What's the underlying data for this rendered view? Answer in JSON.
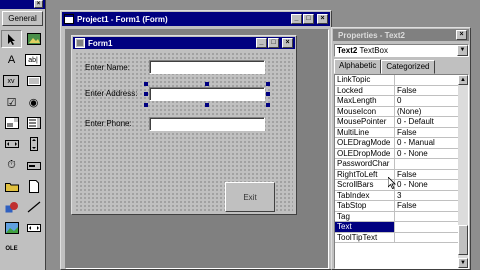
{
  "toolbox": {
    "title_close": "×",
    "general_label": "General",
    "tools": [
      {
        "name": "pointer-icon"
      },
      {
        "name": "picturebox-icon"
      },
      {
        "name": "label-icon",
        "glyph": "A"
      },
      {
        "name": "textbox-icon",
        "glyph": "ab|"
      },
      {
        "name": "frame-icon",
        "glyph": "xv"
      },
      {
        "name": "commandbutton-icon"
      },
      {
        "name": "checkbox-icon",
        "glyph": "☑"
      },
      {
        "name": "optionbutton-icon",
        "glyph": "◉"
      },
      {
        "name": "combobox-icon"
      },
      {
        "name": "listbox-icon"
      },
      {
        "name": "hscrollbar-icon"
      },
      {
        "name": "vscrollbar-icon"
      },
      {
        "name": "timer-icon",
        "glyph": "⏱"
      },
      {
        "name": "drivelistbox-icon"
      },
      {
        "name": "dirlistbox-icon"
      },
      {
        "name": "filelistbox-icon"
      },
      {
        "name": "shape-icon"
      },
      {
        "name": "line-icon"
      },
      {
        "name": "image-icon"
      },
      {
        "name": "data-icon"
      },
      {
        "name": "ole-icon",
        "glyph": "OLE"
      }
    ]
  },
  "project_window": {
    "title": "Project1 - Form1 (Form)",
    "min": "_",
    "max": "□",
    "close": "×"
  },
  "form": {
    "title": "Form1",
    "min": "_",
    "max": "□",
    "close": "×",
    "labels": {
      "name": "Enter Name:",
      "address": "Enter Address:",
      "phone": "Enter Phone:"
    },
    "exit_button": "Exit"
  },
  "properties": {
    "title": "Properties - Text2",
    "close": "×",
    "object_name": "Text2",
    "object_type": "TextBox",
    "tabs": [
      "Alphabetic",
      "Categorized"
    ],
    "rows": [
      {
        "name": "LinkTopic",
        "value": ""
      },
      {
        "name": "Locked",
        "value": "False"
      },
      {
        "name": "MaxLength",
        "value": "0"
      },
      {
        "name": "MouseIcon",
        "value": "(None)"
      },
      {
        "name": "MousePointer",
        "value": "0 - Default"
      },
      {
        "name": "MultiLine",
        "value": "False"
      },
      {
        "name": "OLEDragMode",
        "value": "0 - Manual"
      },
      {
        "name": "OLEDropMode",
        "value": "0 - None"
      },
      {
        "name": "PasswordChar",
        "value": ""
      },
      {
        "name": "RightToLeft",
        "value": "False"
      },
      {
        "name": "ScrollBars",
        "value": "0 - None"
      },
      {
        "name": "TabIndex",
        "value": "3"
      },
      {
        "name": "TabStop",
        "value": "False"
      },
      {
        "name": "Tag",
        "value": ""
      },
      {
        "name": "Text",
        "value": ""
      },
      {
        "name": "ToolTipText",
        "value": ""
      }
    ],
    "selected_row": "Text"
  },
  "colors": {
    "active_title": "#000080",
    "inactive_title": "#808080",
    "face": "#c0c0c0"
  }
}
